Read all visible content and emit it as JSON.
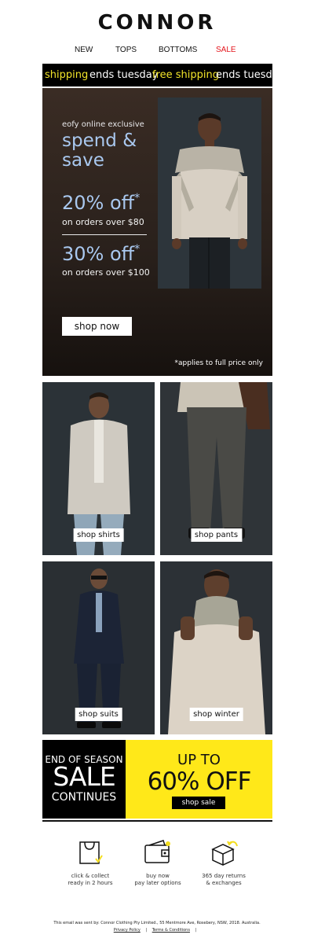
{
  "brand": {
    "name": "CONNOR"
  },
  "nav": {
    "items": [
      "NEW",
      "TOPS",
      "BOTTOMS",
      "SALE"
    ]
  },
  "ticker": {
    "segments": [
      "shipping",
      "ends tuesday",
      "free shipping",
      "ends tuesday"
    ]
  },
  "hero": {
    "kicker": "eofy online exclusive",
    "headline": "spend & save",
    "offers": [
      {
        "amount": "20% off",
        "mark": "*",
        "condition": "on orders over $80"
      },
      {
        "amount": "30% off",
        "mark": "*",
        "condition": "on orders over $100"
      }
    ],
    "cta": "shop now",
    "note": "*applies to full price only"
  },
  "categories": [
    {
      "label": "shop shirts",
      "icon": "man-in-shirt-photo"
    },
    {
      "label": "shop pants",
      "icon": "pants-photo"
    },
    {
      "label": "shop suits",
      "icon": "man-in-suit-photo"
    },
    {
      "label": "shop winter",
      "icon": "man-in-knit-photo"
    }
  ],
  "sale": {
    "left_top": "END OF SEASON",
    "left_main": "SALE",
    "left_bottom": "CONTINUES",
    "right_top": "UP TO",
    "right_main": "60% OFF",
    "cta": "shop sale",
    "colors": {
      "black": "#000000",
      "yellow": "#ffe819"
    }
  },
  "features": [
    {
      "icon": "shopping-bag-icon",
      "text": "click & collect\nready in 2 hours"
    },
    {
      "icon": "wallet-icon",
      "text": "buy now\npay later options"
    },
    {
      "icon": "return-box-icon",
      "text": "365 day returns\n& exchanges"
    }
  ],
  "footer": {
    "sender": "This email was sent by: Connor Clothing Pty Limited., 55 Mentmore Ave, Rosebery, NSW, 2018. Australia.",
    "links": [
      "Privacy Policy",
      "Terms & Conditions"
    ],
    "sep": "|"
  }
}
